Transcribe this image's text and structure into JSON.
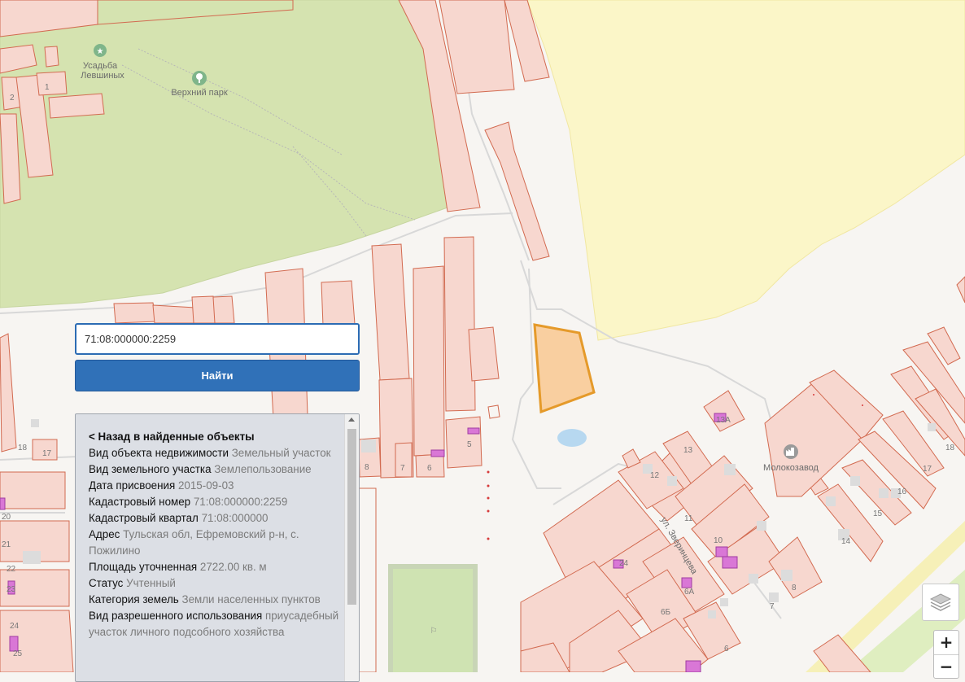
{
  "search": {
    "value": "71:08:000000:2259",
    "button_label": "Найти"
  },
  "info": {
    "back_link": "< Назад в найденные объекты",
    "rows": [
      {
        "label": "Вид объекта недвижимости",
        "value": "Земельный участок"
      },
      {
        "label": "Вид земельного участка",
        "value": "Землепользование"
      },
      {
        "label": "Дата присвоения",
        "value": "2015-09-03"
      },
      {
        "label": "Кадастровый номер",
        "value": "71:08:000000:2259"
      },
      {
        "label": "Кадастровый квартал",
        "value": "71:08:000000"
      },
      {
        "label": "Адрес",
        "value": "Тульская обл, Ефремовский р-н, с. Пожилино"
      },
      {
        "label": "Площадь уточненная",
        "value": "2722.00 кв. м"
      },
      {
        "label": "Статус",
        "value": "Учтенный"
      },
      {
        "label": "Категория земель",
        "value": "Земли населенных пунктов"
      },
      {
        "label": "Вид разрешенного использования",
        "value": "приусадебный участок личного подсобного хозяйства"
      }
    ]
  },
  "map_labels": {
    "estate_line1": "Усадьба",
    "estate_line2": "Левшиных",
    "park": "Верхний парк",
    "dairy": "Молокозавод",
    "street": "ул. Зверинцева"
  },
  "parcel_numbers": [
    "1",
    "2",
    "18",
    "17",
    "20",
    "21",
    "22",
    "23",
    "24",
    "25",
    "8",
    "7",
    "6",
    "5",
    "13А",
    "13",
    "12",
    "11",
    "10",
    "24",
    "6А",
    "6Б",
    "7",
    "8",
    "6",
    "17",
    "18",
    "16",
    "15",
    "14"
  ],
  "controls": {
    "zoom_in": "+",
    "zoom_out": "−",
    "layers_icon": "layers-icon"
  },
  "colors": {
    "highlight_fill": "#f9cfa0",
    "highlight_stroke": "#e59a2a",
    "parcel_fill": "#f7d7cf",
    "parcel_stroke": "#d26a50",
    "park_green": "#d5e3b0",
    "yellow_zone": "#fbf6c8",
    "button_blue": "#3071b8"
  }
}
